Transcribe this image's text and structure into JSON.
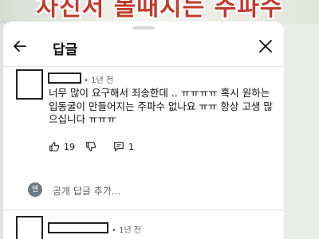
{
  "background_video": {
    "visible_text": "자진서 볼때지는 주파수"
  },
  "header": {
    "title": "답글",
    "back_icon": "arrow-left-icon",
    "close_icon": "close-icon"
  },
  "comment": {
    "time": "1년 전",
    "text": "너무 많이 요구해서 죄송한데 .. ㅠㅠㅠㅠ 혹시 원하는 입동굴이 만들어지는 주파수 없나요 ㅠㅠ 항상 고생 많으십니다 ㅠㅠㅠ",
    "likes": "19",
    "like_icon": "thumbs-up-icon",
    "dislike_icon": "thumbs-down-icon",
    "reply_icon": "comment-reply-icon",
    "replies": "1"
  },
  "reply_box": {
    "avatar_letter": "엔",
    "placeholder": "공개 답글 추가..."
  },
  "next_comment": {
    "time": "1년 전"
  }
}
